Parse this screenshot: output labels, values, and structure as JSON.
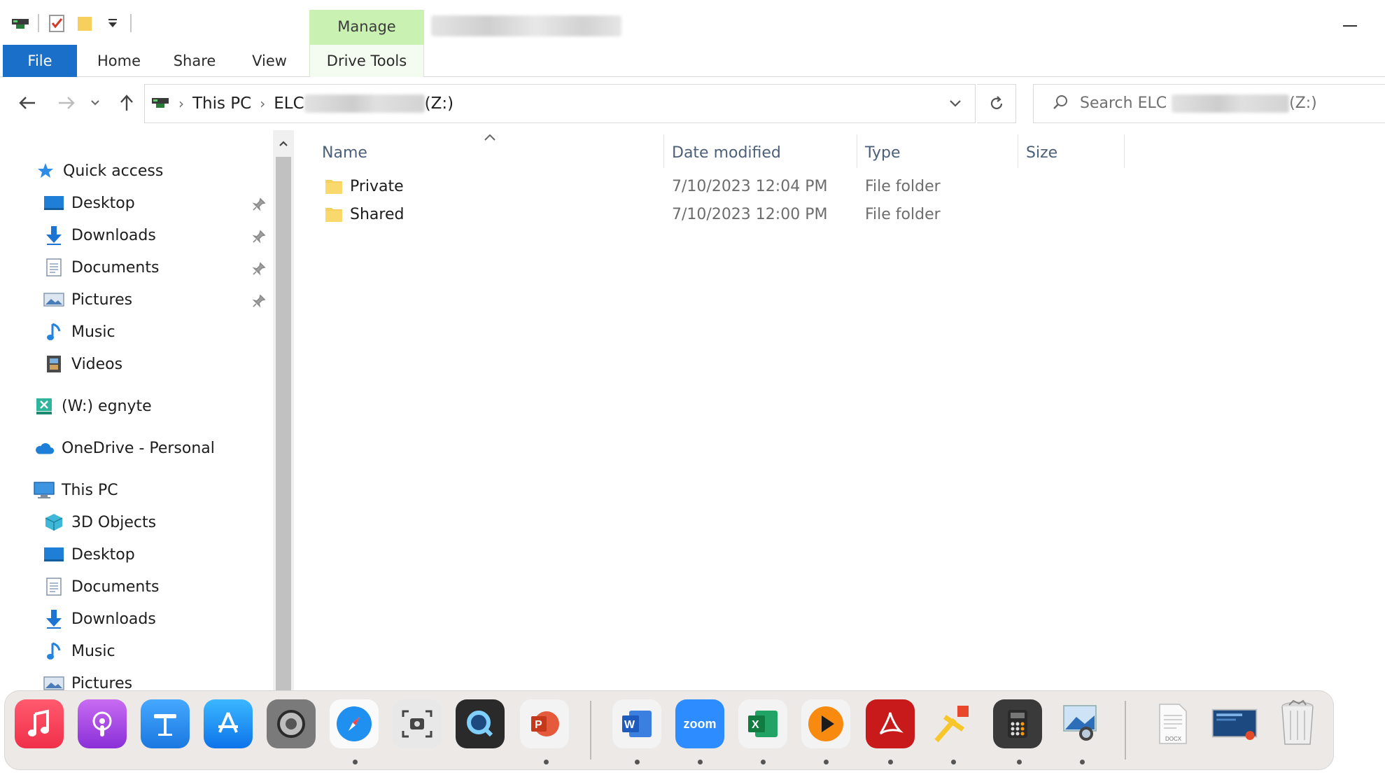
{
  "ribbon": {
    "context_tab": "Manage",
    "tabs": [
      "File",
      "Home",
      "Share",
      "View",
      "Drive Tools"
    ]
  },
  "address": {
    "crumbs": [
      "This PC",
      "ELC",
      "(Z:)"
    ],
    "search_prefix": "Search ELC",
    "search_suffix": "(Z:)"
  },
  "nav": {
    "quick_access": "Quick access",
    "quick_items": [
      "Desktop",
      "Downloads",
      "Documents",
      "Pictures",
      "Music",
      "Videos"
    ],
    "egnyte": "(W:) egnyte",
    "onedrive": "OneDrive - Personal",
    "this_pc": "This PC",
    "pc_items": [
      "3D Objects",
      "Desktop",
      "Documents",
      "Downloads",
      "Music",
      "Pictures"
    ]
  },
  "columns": [
    "Name",
    "Date modified",
    "Type",
    "Size"
  ],
  "files": [
    {
      "name": "Private",
      "date": "7/10/2023 12:04 PM",
      "type": "File folder"
    },
    {
      "name": "Shared",
      "date": "7/10/2023 12:00 PM",
      "type": "File folder"
    }
  ],
  "dock": {
    "apps": [
      "music-app",
      "podcasts-app",
      "keynote-app",
      "app-store",
      "system-preferences",
      "safari",
      "screenshot-app",
      "quicktime",
      "powerpoint",
      "word",
      "zoom",
      "excel",
      "infuse-player",
      "acrobat",
      "pinpoint-app",
      "calculator",
      "preview",
      "docx-file",
      "screen-recording-file",
      "trash"
    ],
    "zoom_label": "zoom"
  },
  "colors": {
    "file_tab": "#1a6fc9",
    "manage_context": "#c9f1b2",
    "folder": "#f6cf5c",
    "column_header": "#4c607a"
  }
}
